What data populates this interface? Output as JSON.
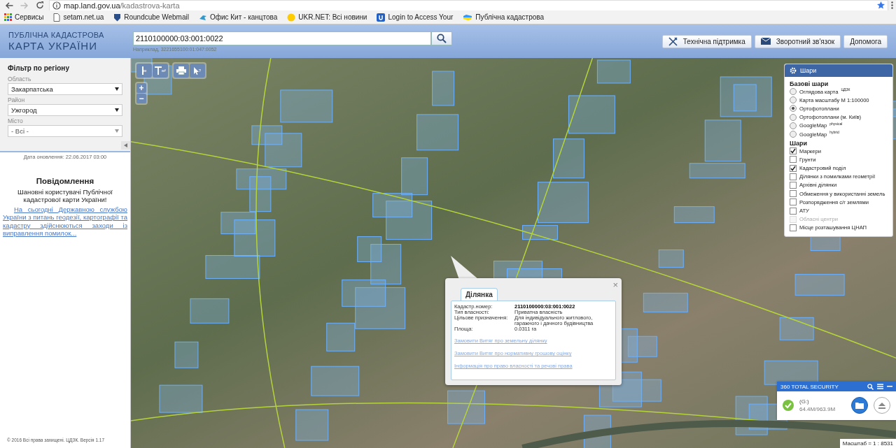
{
  "browser": {
    "url_host": "map.land.gov.ua",
    "url_path": "/kadastrova-karta",
    "bookmarks": [
      {
        "label": "Сервисы",
        "kind": "apps"
      },
      {
        "label": "setam.net.ua",
        "kind": "page"
      },
      {
        "label": "Roundcube Webmail",
        "kind": "shield"
      },
      {
        "label": "Офис Кит - канцтова",
        "kind": "bird"
      },
      {
        "label": "UKR.NET: Всі новини",
        "kind": "circle"
      },
      {
        "label": "Login to Access Your",
        "kind": "u"
      },
      {
        "label": "Публічна кадастрова",
        "kind": "map"
      }
    ]
  },
  "header": {
    "logo_line1": "ПУБЛІЧНА КАДАСТРОВА",
    "logo_line2": "КАРТА УКРАЇНИ",
    "search_value": "2110100000:03:001:0022",
    "search_hint": "Наприклад, 3221655100:01:047:0052",
    "buttons": [
      {
        "label": "Технічна підтримка",
        "kind": "tools"
      },
      {
        "label": "Зворотний зв'язок",
        "kind": "mail"
      },
      {
        "label": "Допомога",
        "kind": "none"
      }
    ]
  },
  "sidebar": {
    "filter_title": "Фільтр по регіону",
    "fields": [
      {
        "label": "Область",
        "value": "Закарпатська",
        "disabled": false
      },
      {
        "label": "Район",
        "value": "Ужгород",
        "disabled": false
      },
      {
        "label": "Місто",
        "value": "- Всі -",
        "disabled": true
      }
    ],
    "update_date": "Дата оновлення: 22.06.2017 03:00",
    "notice_title": "Повідомлення",
    "notice_text": "Шановні користувачі Публічної кадастрової карти України!",
    "notice_link": "На сьогодні Державною службою України з питань геодезії, картографії та кадастру здійснюються заходи із виправлення помилок...",
    "footer": "© 2016 Всі права захищені. ЦДЗК. Версія 1.17"
  },
  "map_tools": [
    {
      "label": "м",
      "kind": "measure-line"
    },
    {
      "label": "м²",
      "kind": "measure-area"
    },
    {
      "kind": "print"
    },
    {
      "label": "?",
      "kind": "identify"
    }
  ],
  "zoom": [
    "+",
    "−"
  ],
  "layers_panel": {
    "title": "Шари",
    "base_title": "Базові шари",
    "base": [
      {
        "label": "Оглядова карта",
        "sup": "ЦДЗК",
        "selected": false
      },
      {
        "label": "Карта масштабу М 1:100000",
        "selected": false
      },
      {
        "label": "Ортофотоплани",
        "selected": true
      },
      {
        "label": "Ортофотоплани (м. Київ)",
        "selected": false
      },
      {
        "label": "GoogleMap",
        "sup": "physical",
        "selected": false
      },
      {
        "label": "GoogleMap",
        "sup": "hybrid",
        "selected": false
      }
    ],
    "layers_title": "Шари",
    "layers": [
      {
        "label": "Маркери",
        "checked": true,
        "disabled": false
      },
      {
        "label": "Грунти",
        "checked": false,
        "disabled": false
      },
      {
        "label": "Кадастровий поділ",
        "checked": true,
        "disabled": false
      },
      {
        "label": "Ділянки з помилками геометрії",
        "checked": false,
        "disabled": false
      },
      {
        "label": "Архівні ділянки",
        "checked": false,
        "disabled": false
      },
      {
        "label": "Обмеження у використанні земель",
        "checked": false,
        "disabled": false
      },
      {
        "label": "Розпорядження с/г землями",
        "checked": false,
        "disabled": false
      },
      {
        "label": "АТУ",
        "checked": false,
        "disabled": false
      },
      {
        "label": "Обласні центри",
        "checked": false,
        "disabled": true
      },
      {
        "label": "Місце розташування ЦНАП",
        "checked": false,
        "disabled": false
      }
    ]
  },
  "popup": {
    "close": "×",
    "tab": "Ділянка",
    "rows": [
      {
        "key": "Кадастр.номер:",
        "value": "2110100000:03:001:0022",
        "bold": true
      },
      {
        "key": "Тип власності:",
        "value": "Приватна власність",
        "bold": false
      },
      {
        "key": "Цільове призначення:",
        "value": "Для індивідуального житлового, гаражного і дачного будівництва",
        "bold": false
      },
      {
        "key": "Площа:",
        "value": "0.0311 га",
        "bold": false
      }
    ],
    "links": [
      "Замовити Витяг про земельну ділянку",
      "Замовити Витяг про нормативну грошову оцінку",
      "Інформація про право власності та речові права"
    ]
  },
  "security_widget": {
    "title": "360 TOTAL SECURITY",
    "drive": "(G:)",
    "size": "64.4M/963.9M"
  },
  "scale": "Масштаб = 1 : 8531"
}
